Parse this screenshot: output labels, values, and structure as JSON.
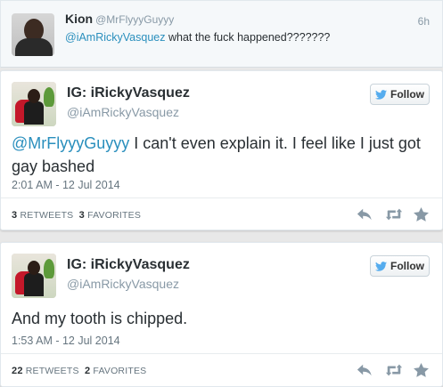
{
  "reply": {
    "name": "Kion",
    "handle": "@MrFlyyyGuyyy",
    "time": "6h",
    "mention": "@iAmRickyVasquez",
    "text": " what the fuck happened???????"
  },
  "tweets": [
    {
      "name": "IG: iRickyVasquez",
      "handle": "@iAmRickyVasquez",
      "follow_label": "Follow",
      "mention": "@MrFlyyyGuyyy",
      "text": " I can't even explain it. I feel like I just got gay bashed",
      "time": "2:01 AM - 12 Jul 2014",
      "retweets_count": "3",
      "retweets_label": "RETWEETS",
      "favorites_count": "3",
      "favorites_label": "FAVORITES"
    },
    {
      "name": "IG: iRickyVasquez",
      "handle": "@iAmRickyVasquez",
      "follow_label": "Follow",
      "text": "And my tooth is chipped.",
      "time": "1:53 AM - 12 Jul 2014",
      "retweets_count": "22",
      "retweets_label": "RETWEETS",
      "favorites_count": "2",
      "favorites_label": "FAVORITES"
    }
  ],
  "icons": [
    "twitter-bird-icon",
    "reply-icon",
    "retweet-icon",
    "favorite-star-icon"
  ],
  "colors": {
    "link": "#2a8fbd",
    "bird": "#55acee",
    "icon": "#8899a6"
  }
}
